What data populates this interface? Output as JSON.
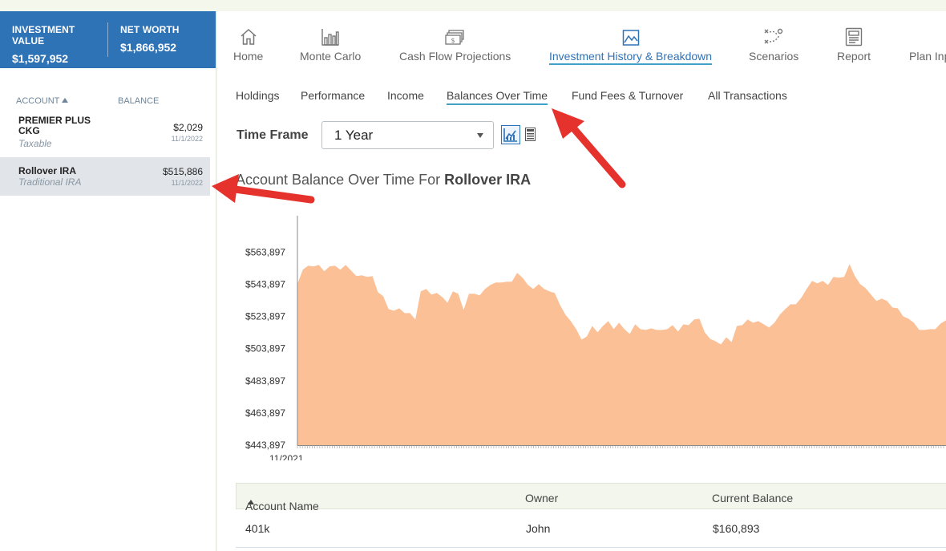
{
  "summary": {
    "investment_label": "INVESTMENT VALUE",
    "investment_value": "$1,597,952",
    "networth_label": "NET WORTH",
    "networth_value": "$1,866,952"
  },
  "accounts": {
    "col_account": "ACCOUNT",
    "col_balance": "BALANCE",
    "items": [
      {
        "name": "PREMIER PLUS CKG",
        "type": "Taxable",
        "balance": "$2,029",
        "date": "11/1/2022"
      },
      {
        "name": "Rollover IRA",
        "type": "Traditional IRA",
        "balance": "$515,886",
        "date": "11/1/2022"
      }
    ]
  },
  "nav": [
    {
      "label": "Home",
      "icon": "home-icon"
    },
    {
      "label": "Monte Carlo",
      "icon": "bar-chart-icon"
    },
    {
      "label": "Cash Flow Projections",
      "icon": "cash-icon"
    },
    {
      "label": "Investment History & Breakdown",
      "icon": "area-chart-icon",
      "active": true
    },
    {
      "label": "Scenarios",
      "icon": "strategy-icon"
    },
    {
      "label": "Report",
      "icon": "report-icon"
    },
    {
      "label": "Plan Inp",
      "icon": ""
    }
  ],
  "subnav": [
    "Holdings",
    "Performance",
    "Income",
    "Balances Over Time",
    "Fund Fees & Turnover",
    "All Transactions"
  ],
  "subnav_active": "Balances Over Time",
  "timeframe": {
    "label": "Time Frame",
    "selected": "1 Year"
  },
  "chart_title": {
    "prefix": "Account Balance Over Time For ",
    "account": "Rollover IRA"
  },
  "chart_data": {
    "type": "area",
    "title": "Account Balance Over Time For Rollover IRA",
    "xlabel": "",
    "ylabel": "",
    "y_ticks": [
      "$443,897",
      "$463,897",
      "$483,897",
      "$503,897",
      "$523,897",
      "$543,897",
      "$563,897"
    ],
    "ylim": [
      443897,
      563897
    ],
    "x_tick_labels": [
      "11/2021"
    ],
    "series": [
      {
        "color": "#fbc096",
        "values": [
          544000,
          553000,
          555500,
          555000,
          556000,
          552000,
          555000,
          555500,
          553000,
          556000,
          552500,
          549000,
          549500,
          548500,
          549000,
          539000,
          536500,
          528500,
          527500,
          529000,
          526000,
          526000,
          522000,
          539500,
          541000,
          537500,
          538500,
          536000,
          532500,
          539500,
          538000,
          528000,
          538000,
          538000,
          537000,
          541000,
          543500,
          545000,
          545000,
          545500,
          545500,
          551000,
          548000,
          543500,
          541000,
          544000,
          541000,
          539500,
          538500,
          531000,
          525000,
          521000,
          516000,
          509500,
          511500,
          518000,
          514000,
          518000,
          521000,
          516000,
          520000,
          516000,
          513000,
          519000,
          516000,
          515500,
          516500,
          515500,
          515500,
          516000,
          518500,
          514500,
          519000,
          518500,
          522000,
          522500,
          514000,
          510000,
          508500,
          506500,
          511000,
          508000,
          518000,
          518500,
          522000,
          520000,
          521000,
          519000,
          517000,
          520000,
          525000,
          528500,
          531500,
          531500,
          535500,
          541000,
          546000,
          544500,
          546000,
          543500,
          548500,
          548000,
          548500,
          556500,
          549000,
          544000,
          541500,
          537500,
          533500,
          535000,
          533500,
          529500,
          529000,
          524000,
          522500,
          520000,
          515500,
          515500,
          516000,
          516000,
          519500,
          521500
        ]
      }
    ],
    "grid": false,
    "legend": "none"
  },
  "table": {
    "headers": [
      "Account Name",
      "Owner",
      "Current Balance"
    ],
    "rows": [
      {
        "account": "401k",
        "owner": "John",
        "balance": "$160,893"
      }
    ]
  },
  "colors": {
    "brand": "#2f73b7",
    "accent": "#3fa0c8",
    "area": "#fbc096",
    "annotation": "#e5322d"
  }
}
